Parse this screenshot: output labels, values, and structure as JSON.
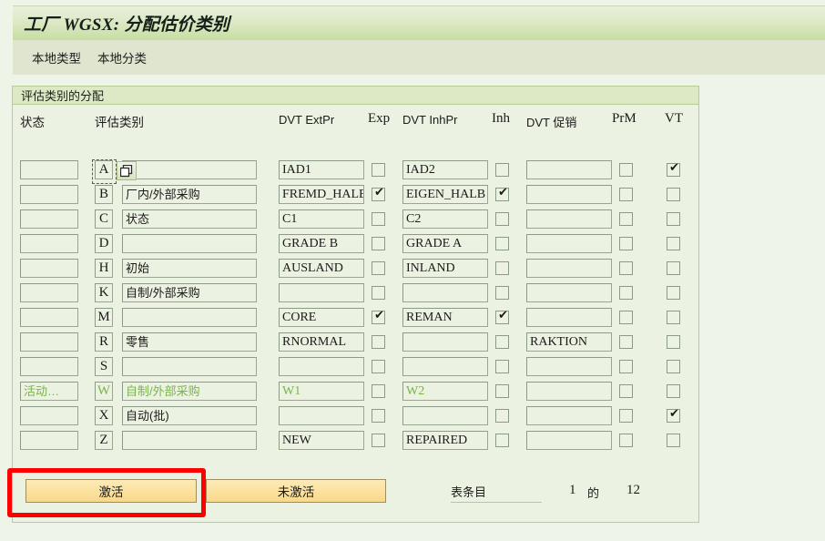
{
  "window": {
    "title": "工厂 WGSX: 分配估价类别"
  },
  "menu": {
    "items": [
      {
        "label": "本地类型"
      },
      {
        "label": "本地分类"
      }
    ]
  },
  "group": {
    "title": "评估类别的分配"
  },
  "columns": {
    "status": "状态",
    "category": "评估类别",
    "ext_pr": "DVT ExtPr",
    "exp": "Exp",
    "inh_pr": "DVT InhPr",
    "inh": "Inh",
    "promo": "DVT 促销",
    "prm": "PrM",
    "vt": "VT"
  },
  "rows": [
    {
      "status": "",
      "key": "A",
      "desc": "",
      "ext_pr": "IAD1",
      "exp": false,
      "inh_pr": "IAD2",
      "inh": false,
      "promo": "",
      "prm": false,
      "vt": true,
      "highlight": false,
      "focused": true
    },
    {
      "status": "",
      "key": "B",
      "desc": "厂内/外部采购",
      "ext_pr": "FREMD_HALB",
      "exp": true,
      "inh_pr": "EIGEN_HALB",
      "inh": true,
      "promo": "",
      "prm": false,
      "vt": false,
      "highlight": false,
      "focused": false
    },
    {
      "status": "",
      "key": "C",
      "desc": "状态",
      "ext_pr": "C1",
      "exp": false,
      "inh_pr": "C2",
      "inh": false,
      "promo": "",
      "prm": false,
      "vt": false,
      "highlight": false,
      "focused": false
    },
    {
      "status": "",
      "key": "D",
      "desc": "",
      "ext_pr": "GRADE B",
      "exp": false,
      "inh_pr": "GRADE A",
      "inh": false,
      "promo": "",
      "prm": false,
      "vt": false,
      "highlight": false,
      "focused": false
    },
    {
      "status": "",
      "key": "H",
      "desc": "初始",
      "ext_pr": "AUSLAND",
      "exp": false,
      "inh_pr": "INLAND",
      "inh": false,
      "promo": "",
      "prm": false,
      "vt": false,
      "highlight": false,
      "focused": false
    },
    {
      "status": "",
      "key": "K",
      "desc": "自制/外部采购",
      "ext_pr": "",
      "exp": false,
      "inh_pr": "",
      "inh": false,
      "promo": "",
      "prm": false,
      "vt": false,
      "highlight": false,
      "focused": false
    },
    {
      "status": "",
      "key": "M",
      "desc": "",
      "ext_pr": "CORE",
      "exp": true,
      "inh_pr": "REMAN",
      "inh": true,
      "promo": "",
      "prm": false,
      "vt": false,
      "highlight": false,
      "focused": false
    },
    {
      "status": "",
      "key": "R",
      "desc": "零售",
      "ext_pr": "RNORMAL",
      "exp": false,
      "inh_pr": "",
      "inh": false,
      "promo": "RAKTION",
      "prm": false,
      "vt": false,
      "highlight": false,
      "focused": false
    },
    {
      "status": "",
      "key": "S",
      "desc": "",
      "ext_pr": "",
      "exp": false,
      "inh_pr": "",
      "inh": false,
      "promo": "",
      "prm": false,
      "vt": false,
      "highlight": false,
      "focused": false
    },
    {
      "status": "活动…",
      "key": "W",
      "desc": "自制/外部采购",
      "ext_pr": "W1",
      "exp": false,
      "inh_pr": "W2",
      "inh": false,
      "promo": "",
      "prm": false,
      "vt": false,
      "highlight": true,
      "focused": false
    },
    {
      "status": "",
      "key": "X",
      "desc": "自动(批)",
      "ext_pr": "",
      "exp": false,
      "inh_pr": "",
      "inh": false,
      "promo": "",
      "prm": false,
      "vt": true,
      "highlight": false,
      "focused": false
    },
    {
      "status": "",
      "key": "Z",
      "desc": "",
      "ext_pr": "NEW",
      "exp": false,
      "inh_pr": "REPAIRED",
      "inh": false,
      "promo": "",
      "prm": false,
      "vt": false,
      "highlight": false,
      "focused": false
    }
  ],
  "footer": {
    "activate_label": "激活",
    "deactivate_label": "未激活",
    "table_entry_label": "表条目",
    "current_entry": "1",
    "of_label": "的",
    "total_entries": "12"
  },
  "icons": {
    "duplicate": "duplicate-icon"
  },
  "colors": {
    "page_background": "#eff4e9",
    "panel_background": "#ecf2e2",
    "title_gradient_end": "#c7dda2",
    "menu_background": "#dfe5cf",
    "button_yellow": "#fce2a0",
    "highlight_red": "#ff0000",
    "active_green": "#79b34a"
  }
}
